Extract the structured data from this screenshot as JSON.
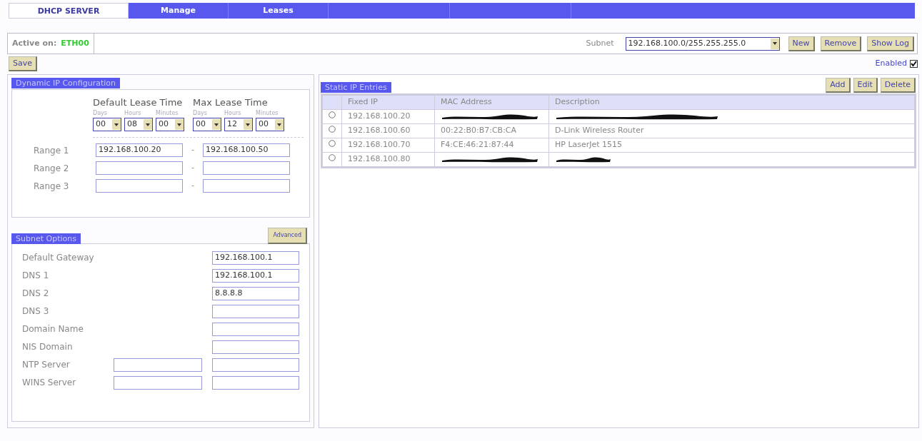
{
  "tabs": [
    {
      "label": "DHCP SERVER",
      "selected": true
    },
    {
      "label": "Manage",
      "selected": false
    },
    {
      "label": "Leases",
      "selected": false
    }
  ],
  "active_on": {
    "label": "Active on:",
    "value": "ETH00"
  },
  "subnet": {
    "label": "Subnet",
    "value": "192.168.100.0/255.255.255.0"
  },
  "top_buttons": [
    "New",
    "Remove",
    "Show Log"
  ],
  "save_button": "Save",
  "enabled": {
    "label": "Enabled",
    "checked": true
  },
  "dynamic_ip": {
    "title": "Dynamic IP Configuration",
    "lease_times": [
      {
        "title": "Default Lease Time",
        "units": [
          {
            "label": "Days",
            "value": "00"
          },
          {
            "label": "Hours",
            "value": "08"
          },
          {
            "label": "Minutes",
            "value": "00"
          }
        ]
      },
      {
        "title": "Max Lease Time",
        "units": [
          {
            "label": "Days",
            "value": "00"
          },
          {
            "label": "Hours",
            "value": "12"
          },
          {
            "label": "Minutes",
            "value": "00"
          }
        ]
      }
    ],
    "ranges": [
      {
        "label": "Range 1",
        "start": "192.168.100.20",
        "end": "192.168.100.50",
        "separator": "-"
      },
      {
        "label": "Range 2",
        "separator": "-"
      },
      {
        "label": "Range 3",
        "separator": "-"
      }
    ]
  },
  "subnet_options": {
    "title": "Subnet Options",
    "advanced_button": "Advanced",
    "fields": [
      {
        "label": "Default Gateway",
        "values": [
          "192.168.100.1"
        ],
        "kind": "single"
      },
      {
        "label": "DNS 1",
        "values": [
          "192.168.100.1"
        ],
        "kind": "single"
      },
      {
        "label": "DNS 2",
        "values": [
          "8.8.8.8"
        ],
        "kind": "single"
      },
      {
        "label": "DNS 3",
        "kind": "single"
      },
      {
        "label": "Domain Name",
        "kind": "single"
      },
      {
        "label": "NIS Domain",
        "kind": "single"
      },
      {
        "label": "NTP Server",
        "kind": "double"
      },
      {
        "label": "WINS Server",
        "kind": "double"
      }
    ]
  },
  "static_ip": {
    "title": "Static IP Entries",
    "buttons": [
      "Add",
      "Edit",
      "Delete"
    ],
    "columns": [
      "Fixed IP",
      "MAC Address",
      "Description"
    ],
    "rows": [
      {
        "selected": false,
        "fixed_ip": "192.168.100.20",
        "mac_redacted": true,
        "description_redacted": true
      },
      {
        "selected": false,
        "fixed_ip": "192.168.100.60",
        "mac_address": "00:22:B0:B7:CB:CA",
        "mac_redacted": false,
        "description": "D-Link Wireless Router",
        "description_redacted": false
      },
      {
        "selected": false,
        "fixed_ip": "192.168.100.70",
        "mac_address": "F4:CE:46:21:87:44",
        "mac_redacted": false,
        "description": "HP LaserJet 1515",
        "description_redacted": false
      },
      {
        "selected": false,
        "fixed_ip": "192.168.100.80",
        "mac_redacted": true,
        "description_redacted": true
      }
    ]
  }
}
